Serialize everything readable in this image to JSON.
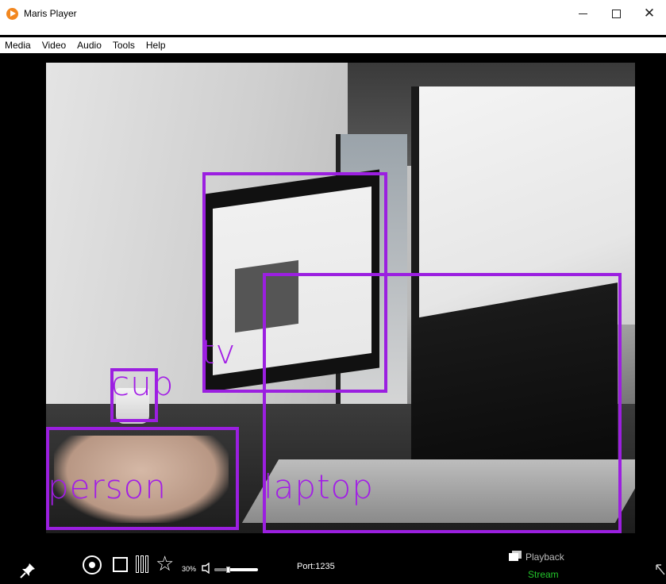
{
  "window": {
    "title": "Maris Player",
    "controls": {
      "minimize": "—",
      "maximize": "☐",
      "close": "✕"
    }
  },
  "menu": [
    "Media",
    "Video",
    "Audio",
    "Tools",
    "Help"
  ],
  "detections": [
    {
      "label": "tv"
    },
    {
      "label": "laptop"
    },
    {
      "label": "cup"
    },
    {
      "label": "person"
    }
  ],
  "colors": {
    "bbox": "#9b1fe0",
    "label": "#a21de6",
    "stream": "#22c42a"
  },
  "controls": {
    "volume_label": "30%",
    "volume_level": 0.3,
    "port_label": "Port:1235",
    "playback_label": "Playback",
    "stream_label": "Stream",
    "icons": [
      "pin-icon",
      "record-icon",
      "stop-icon",
      "pause-icon",
      "star-icon",
      "speaker-icon",
      "playback-icon",
      "edge-icon"
    ]
  }
}
